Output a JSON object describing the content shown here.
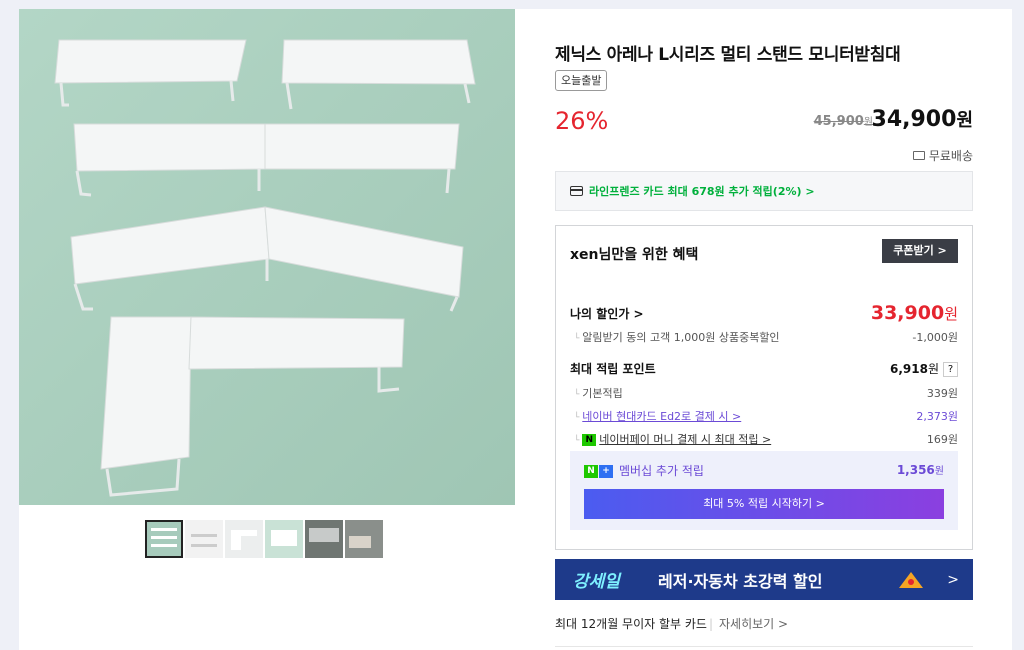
{
  "product": {
    "title": "제닉스 아레나 L시리즈 멀티 스탠드 모니터받침대",
    "tag": "오늘출발",
    "discount_rate": "26%",
    "original_price": "45,900",
    "original_unit": "원",
    "price": "34,900",
    "price_unit": "원",
    "shipping": "무료배송"
  },
  "card_promo": "라인프렌즈 카드 최대 678원 추가 적립(2%) >",
  "benefit": {
    "title": "xen님만을 위한 혜택",
    "coupon_button": "쿠폰받기 >",
    "my_price_label": "나의 할인가 >",
    "my_price_value": "33,900",
    "my_price_unit": "원",
    "alarm_label": "알림받기 동의 고객 1,000원 상품중복할인",
    "alarm_value": "-1,000원",
    "points_label": "최대 적립 포인트",
    "points_value": "6,918",
    "points_unit": "원",
    "basic_label": "기본적립",
    "basic_value": "339원",
    "hyundai_label": "네이버 현대카드 Ed2로 결제 시 >",
    "hyundai_value": "2,373원",
    "npay_label": "네이버페이 머니 결제 시 최대 적립 >",
    "npay_value": "169원",
    "member_label": "멤버십 추가 적립",
    "member_value": "1,356",
    "member_unit": "원",
    "member_button": "최대 5% 적립 시작하기 >"
  },
  "banner": {
    "logo": "강세일",
    "text": "레저·자동차 초강력 할인",
    "arrow": ">"
  },
  "installment": {
    "text": "최대 12개월 무이자 할부 카드",
    "more": "자세히보기 >"
  },
  "colors": {
    "accent_red": "#e5252f",
    "naver_green": "#00b03c",
    "purple": "#6b4ad6",
    "banner_bg": "#1e3a8a"
  }
}
